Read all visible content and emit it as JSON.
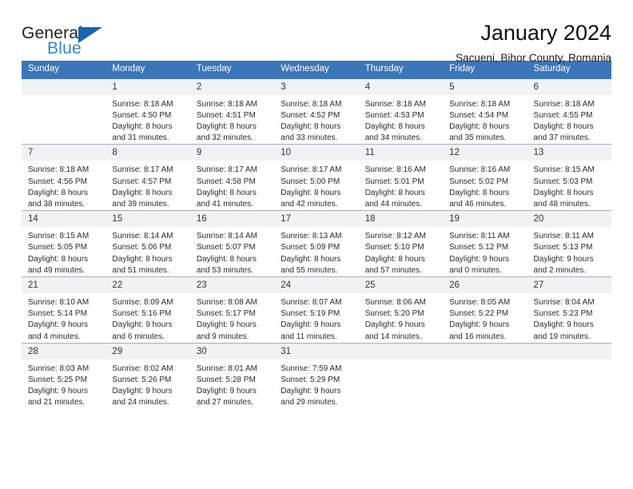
{
  "brand": {
    "name_part1": "General",
    "name_part2": "Blue",
    "accent_color": "#1567ae",
    "secondary_color": "#2e86d4"
  },
  "header": {
    "title": "January 2024",
    "subtitle": "Sacueni, Bihor County, Romania"
  },
  "theme": {
    "header_bar_color": "#3a76b8",
    "daynum_band_color": "#f2f2f2",
    "grid_line_color": "#97b4d0"
  },
  "weekday_headers": [
    "Sunday",
    "Monday",
    "Tuesday",
    "Wednesday",
    "Thursday",
    "Friday",
    "Saturday"
  ],
  "weeks": [
    {
      "days": [
        {
          "num": "",
          "sunrise": "",
          "sunset": "",
          "daylight_line1": "",
          "daylight_line2": ""
        },
        {
          "num": "1",
          "sunrise": "Sunrise: 8:18 AM",
          "sunset": "Sunset: 4:50 PM",
          "daylight_line1": "Daylight: 8 hours",
          "daylight_line2": "and 31 minutes."
        },
        {
          "num": "2",
          "sunrise": "Sunrise: 8:18 AM",
          "sunset": "Sunset: 4:51 PM",
          "daylight_line1": "Daylight: 8 hours",
          "daylight_line2": "and 32 minutes."
        },
        {
          "num": "3",
          "sunrise": "Sunrise: 8:18 AM",
          "sunset": "Sunset: 4:52 PM",
          "daylight_line1": "Daylight: 8 hours",
          "daylight_line2": "and 33 minutes."
        },
        {
          "num": "4",
          "sunrise": "Sunrise: 8:18 AM",
          "sunset": "Sunset: 4:53 PM",
          "daylight_line1": "Daylight: 8 hours",
          "daylight_line2": "and 34 minutes."
        },
        {
          "num": "5",
          "sunrise": "Sunrise: 8:18 AM",
          "sunset": "Sunset: 4:54 PM",
          "daylight_line1": "Daylight: 8 hours",
          "daylight_line2": "and 35 minutes."
        },
        {
          "num": "6",
          "sunrise": "Sunrise: 8:18 AM",
          "sunset": "Sunset: 4:55 PM",
          "daylight_line1": "Daylight: 8 hours",
          "daylight_line2": "and 37 minutes."
        }
      ]
    },
    {
      "days": [
        {
          "num": "7",
          "sunrise": "Sunrise: 8:18 AM",
          "sunset": "Sunset: 4:56 PM",
          "daylight_line1": "Daylight: 8 hours",
          "daylight_line2": "and 38 minutes."
        },
        {
          "num": "8",
          "sunrise": "Sunrise: 8:17 AM",
          "sunset": "Sunset: 4:57 PM",
          "daylight_line1": "Daylight: 8 hours",
          "daylight_line2": "and 39 minutes."
        },
        {
          "num": "9",
          "sunrise": "Sunrise: 8:17 AM",
          "sunset": "Sunset: 4:58 PM",
          "daylight_line1": "Daylight: 8 hours",
          "daylight_line2": "and 41 minutes."
        },
        {
          "num": "10",
          "sunrise": "Sunrise: 8:17 AM",
          "sunset": "Sunset: 5:00 PM",
          "daylight_line1": "Daylight: 8 hours",
          "daylight_line2": "and 42 minutes."
        },
        {
          "num": "11",
          "sunrise": "Sunrise: 8:16 AM",
          "sunset": "Sunset: 5:01 PM",
          "daylight_line1": "Daylight: 8 hours",
          "daylight_line2": "and 44 minutes."
        },
        {
          "num": "12",
          "sunrise": "Sunrise: 8:16 AM",
          "sunset": "Sunset: 5:02 PM",
          "daylight_line1": "Daylight: 8 hours",
          "daylight_line2": "and 46 minutes."
        },
        {
          "num": "13",
          "sunrise": "Sunrise: 8:15 AM",
          "sunset": "Sunset: 5:03 PM",
          "daylight_line1": "Daylight: 8 hours",
          "daylight_line2": "and 48 minutes."
        }
      ]
    },
    {
      "days": [
        {
          "num": "14",
          "sunrise": "Sunrise: 8:15 AM",
          "sunset": "Sunset: 5:05 PM",
          "daylight_line1": "Daylight: 8 hours",
          "daylight_line2": "and 49 minutes."
        },
        {
          "num": "15",
          "sunrise": "Sunrise: 8:14 AM",
          "sunset": "Sunset: 5:06 PM",
          "daylight_line1": "Daylight: 8 hours",
          "daylight_line2": "and 51 minutes."
        },
        {
          "num": "16",
          "sunrise": "Sunrise: 8:14 AM",
          "sunset": "Sunset: 5:07 PM",
          "daylight_line1": "Daylight: 8 hours",
          "daylight_line2": "and 53 minutes."
        },
        {
          "num": "17",
          "sunrise": "Sunrise: 8:13 AM",
          "sunset": "Sunset: 5:09 PM",
          "daylight_line1": "Daylight: 8 hours",
          "daylight_line2": "and 55 minutes."
        },
        {
          "num": "18",
          "sunrise": "Sunrise: 8:12 AM",
          "sunset": "Sunset: 5:10 PM",
          "daylight_line1": "Daylight: 8 hours",
          "daylight_line2": "and 57 minutes."
        },
        {
          "num": "19",
          "sunrise": "Sunrise: 8:11 AM",
          "sunset": "Sunset: 5:12 PM",
          "daylight_line1": "Daylight: 9 hours",
          "daylight_line2": "and 0 minutes."
        },
        {
          "num": "20",
          "sunrise": "Sunrise: 8:11 AM",
          "sunset": "Sunset: 5:13 PM",
          "daylight_line1": "Daylight: 9 hours",
          "daylight_line2": "and 2 minutes."
        }
      ]
    },
    {
      "days": [
        {
          "num": "21",
          "sunrise": "Sunrise: 8:10 AM",
          "sunset": "Sunset: 5:14 PM",
          "daylight_line1": "Daylight: 9 hours",
          "daylight_line2": "and 4 minutes."
        },
        {
          "num": "22",
          "sunrise": "Sunrise: 8:09 AM",
          "sunset": "Sunset: 5:16 PM",
          "daylight_line1": "Daylight: 9 hours",
          "daylight_line2": "and 6 minutes."
        },
        {
          "num": "23",
          "sunrise": "Sunrise: 8:08 AM",
          "sunset": "Sunset: 5:17 PM",
          "daylight_line1": "Daylight: 9 hours",
          "daylight_line2": "and 9 minutes."
        },
        {
          "num": "24",
          "sunrise": "Sunrise: 8:07 AM",
          "sunset": "Sunset: 5:19 PM",
          "daylight_line1": "Daylight: 9 hours",
          "daylight_line2": "and 11 minutes."
        },
        {
          "num": "25",
          "sunrise": "Sunrise: 8:06 AM",
          "sunset": "Sunset: 5:20 PM",
          "daylight_line1": "Daylight: 9 hours",
          "daylight_line2": "and 14 minutes."
        },
        {
          "num": "26",
          "sunrise": "Sunrise: 8:05 AM",
          "sunset": "Sunset: 5:22 PM",
          "daylight_line1": "Daylight: 9 hours",
          "daylight_line2": "and 16 minutes."
        },
        {
          "num": "27",
          "sunrise": "Sunrise: 8:04 AM",
          "sunset": "Sunset: 5:23 PM",
          "daylight_line1": "Daylight: 9 hours",
          "daylight_line2": "and 19 minutes."
        }
      ]
    },
    {
      "days": [
        {
          "num": "28",
          "sunrise": "Sunrise: 8:03 AM",
          "sunset": "Sunset: 5:25 PM",
          "daylight_line1": "Daylight: 9 hours",
          "daylight_line2": "and 21 minutes."
        },
        {
          "num": "29",
          "sunrise": "Sunrise: 8:02 AM",
          "sunset": "Sunset: 5:26 PM",
          "daylight_line1": "Daylight: 9 hours",
          "daylight_line2": "and 24 minutes."
        },
        {
          "num": "30",
          "sunrise": "Sunrise: 8:01 AM",
          "sunset": "Sunset: 5:28 PM",
          "daylight_line1": "Daylight: 9 hours",
          "daylight_line2": "and 27 minutes."
        },
        {
          "num": "31",
          "sunrise": "Sunrise: 7:59 AM",
          "sunset": "Sunset: 5:29 PM",
          "daylight_line1": "Daylight: 9 hours",
          "daylight_line2": "and 29 minutes."
        },
        {
          "num": "",
          "sunrise": "",
          "sunset": "",
          "daylight_line1": "",
          "daylight_line2": ""
        },
        {
          "num": "",
          "sunrise": "",
          "sunset": "",
          "daylight_line1": "",
          "daylight_line2": ""
        },
        {
          "num": "",
          "sunrise": "",
          "sunset": "",
          "daylight_line1": "",
          "daylight_line2": ""
        }
      ]
    }
  ]
}
